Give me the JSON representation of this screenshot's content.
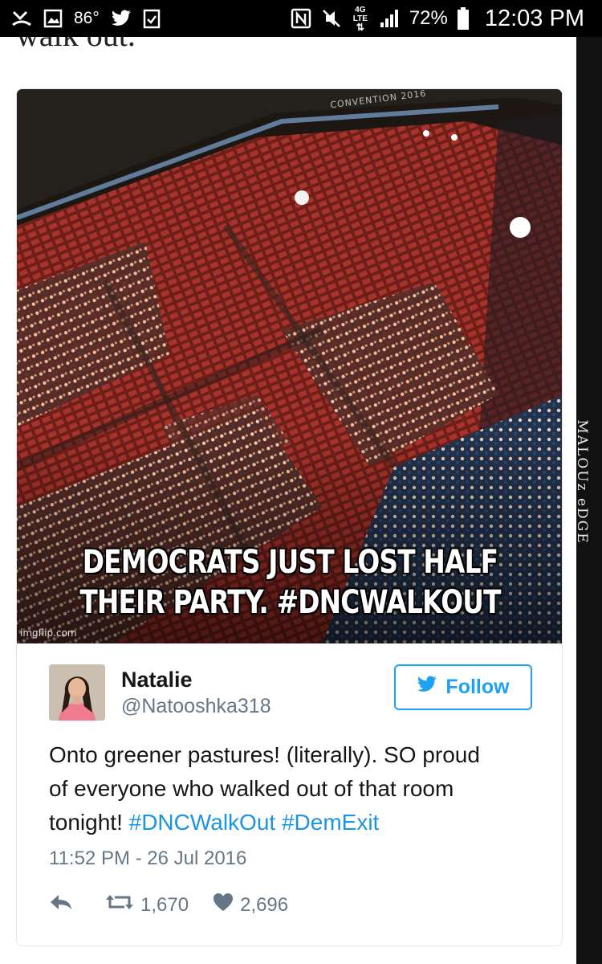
{
  "status_bar": {
    "temperature": "86°",
    "network": "4G LTE",
    "battery": "72%",
    "time": "12:03 PM"
  },
  "page": {
    "cut_text_top": "walk out.",
    "watermark": "MALOUz eDGE"
  },
  "tweet": {
    "media": {
      "banner": "CONVENTION 2016",
      "caption_line_1": "DEMOCRATS JUST LOST HALF",
      "caption_line_2": "THEIR PARTY. #DNCWALKOUT",
      "credit": "imgflip.com"
    },
    "author": {
      "display_name": "Natalie",
      "handle": "@Natooshka318"
    },
    "follow_label": "Follow",
    "text": {
      "line1": "Onto greener pastures! (literally). SO proud",
      "line2": "of everyone who walked out of that room",
      "line3_plain": "tonight! ",
      "hashtag1": "#DNCWalkOut",
      "hashtag2": "#DemExit"
    },
    "timestamp": "11:52 PM - 26 Jul 2016",
    "retweets": "1,670",
    "likes": "2,696"
  },
  "colors": {
    "accent": "#1da1f2",
    "link": "#1b95e0",
    "muted": "#657786"
  }
}
